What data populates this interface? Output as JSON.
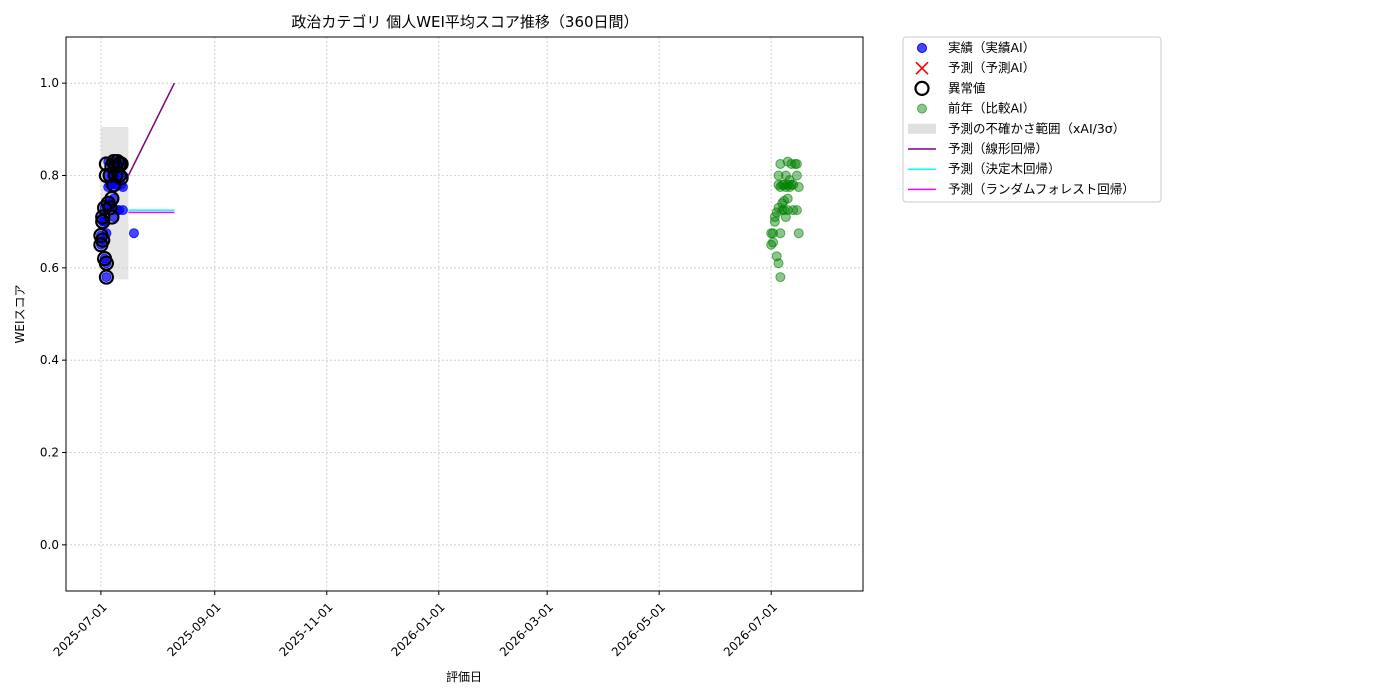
{
  "chart_data": {
    "type": "scatter",
    "title": "政治カテゴリ 個人WEI平均スコア推移（360日間）",
    "xlabel": "評価日",
    "ylabel": "WEIスコア",
    "x_axis": "date",
    "xlim": [
      "2025-06-12",
      "2026-08-20"
    ],
    "ylim": [
      -0.1,
      1.1
    ],
    "x_ticks": [
      "2025-07-01",
      "2025-09-01",
      "2025-11-01",
      "2026-01-01",
      "2026-03-01",
      "2026-05-01",
      "2026-07-01"
    ],
    "y_ticks": [
      0.0,
      0.2,
      0.4,
      0.6,
      0.8,
      1.0
    ],
    "y_tick_labels": [
      "0.0",
      "0.2",
      "0.4",
      "0.6",
      "0.8",
      "1.0"
    ],
    "grid": true,
    "legend_placement": "outside-right",
    "colors": {
      "actual": "#0000ff",
      "predicted": "#ff0000",
      "anomaly": "#000000",
      "previous_year": "#008000",
      "uncertainty": "#d3d3d3",
      "linear": "#800080",
      "tree": "#00ffff",
      "forest": "#ff00ff"
    },
    "series": [
      {
        "name": "実績（実績AI）",
        "kind": "scatter",
        "points": [
          [
            "2025-07-01",
            0.65
          ],
          [
            "2025-07-01",
            0.67
          ],
          [
            "2025-07-02",
            0.66
          ],
          [
            "2025-07-02",
            0.7
          ],
          [
            "2025-07-02",
            0.71
          ],
          [
            "2025-07-03",
            0.62
          ],
          [
            "2025-07-03",
            0.7
          ],
          [
            "2025-07-03",
            0.73
          ],
          [
            "2025-07-04",
            0.61
          ],
          [
            "2025-07-04",
            0.58
          ],
          [
            "2025-07-04",
            0.675
          ],
          [
            "2025-07-05",
            0.8
          ],
          [
            "2025-07-05",
            0.83
          ],
          [
            "2025-07-05",
            0.775
          ],
          [
            "2025-07-05",
            0.74
          ],
          [
            "2025-07-06",
            0.745
          ],
          [
            "2025-07-06",
            0.73
          ],
          [
            "2025-07-06",
            0.78
          ],
          [
            "2025-07-07",
            0.78
          ],
          [
            "2025-07-07",
            0.8
          ],
          [
            "2025-07-07",
            0.82
          ],
          [
            "2025-07-08",
            0.71
          ],
          [
            "2025-07-08",
            0.83
          ],
          [
            "2025-07-08",
            0.75
          ],
          [
            "2025-07-09",
            0.8
          ],
          [
            "2025-07-09",
            0.78
          ],
          [
            "2025-07-10",
            0.82
          ],
          [
            "2025-07-10",
            0.725
          ],
          [
            "2025-07-10",
            0.78
          ],
          [
            "2025-07-11",
            0.8
          ],
          [
            "2025-07-11",
            0.83
          ],
          [
            "2025-07-11",
            0.725
          ],
          [
            "2025-07-12",
            0.825
          ],
          [
            "2025-07-12",
            0.78
          ],
          [
            "2025-07-13",
            0.8
          ],
          [
            "2025-07-13",
            0.725
          ],
          [
            "2025-07-13",
            0.775
          ],
          [
            "2025-07-19",
            0.675
          ]
        ]
      },
      {
        "name": "予測（予測AI）",
        "kind": "scatter",
        "points": []
      },
      {
        "name": "異常値",
        "kind": "scatter",
        "points": [
          [
            "2025-07-01",
            0.65
          ],
          [
            "2025-07-01",
            0.67
          ],
          [
            "2025-07-02",
            0.66
          ],
          [
            "2025-07-02",
            0.7
          ],
          [
            "2025-07-02",
            0.71
          ],
          [
            "2025-07-03",
            0.62
          ],
          [
            "2025-07-03",
            0.73
          ],
          [
            "2025-07-04",
            0.61
          ],
          [
            "2025-07-04",
            0.58
          ],
          [
            "2025-07-04",
            0.8
          ],
          [
            "2025-07-04",
            0.825
          ],
          [
            "2025-07-05",
            0.74
          ],
          [
            "2025-07-06",
            0.73
          ],
          [
            "2025-07-06",
            0.8
          ],
          [
            "2025-07-07",
            0.82
          ],
          [
            "2025-07-07",
            0.71
          ],
          [
            "2025-07-07",
            0.75
          ],
          [
            "2025-07-08",
            0.83
          ],
          [
            "2025-07-08",
            0.78
          ],
          [
            "2025-07-09",
            0.8
          ],
          [
            "2025-07-09",
            0.82
          ],
          [
            "2025-07-10",
            0.83
          ],
          [
            "2025-07-11",
            0.8
          ],
          [
            "2025-07-11",
            0.825
          ],
          [
            "2025-07-12",
            0.825
          ],
          [
            "2025-07-12",
            0.795
          ]
        ]
      },
      {
        "name": "前年（比較AI）",
        "kind": "scatter",
        "points": [
          [
            "2026-07-01",
            0.675
          ],
          [
            "2026-07-01",
            0.65
          ],
          [
            "2026-07-02",
            0.675
          ],
          [
            "2026-07-02",
            0.655
          ],
          [
            "2026-07-03",
            0.71
          ],
          [
            "2026-07-03",
            0.7
          ],
          [
            "2026-07-04",
            0.625
          ],
          [
            "2026-07-04",
            0.72
          ],
          [
            "2026-07-05",
            0.61
          ],
          [
            "2026-07-05",
            0.73
          ],
          [
            "2026-07-05",
            0.78
          ],
          [
            "2026-07-05",
            0.8
          ],
          [
            "2026-07-06",
            0.58
          ],
          [
            "2026-07-06",
            0.825
          ],
          [
            "2026-07-06",
            0.675
          ],
          [
            "2026-07-06",
            0.775
          ],
          [
            "2026-07-07",
            0.74
          ],
          [
            "2026-07-07",
            0.725
          ],
          [
            "2026-07-07",
            0.78
          ],
          [
            "2026-07-08",
            0.745
          ],
          [
            "2026-07-08",
            0.78
          ],
          [
            "2026-07-08",
            0.725
          ],
          [
            "2026-07-09",
            0.8
          ],
          [
            "2026-07-09",
            0.775
          ],
          [
            "2026-07-09",
            0.71
          ],
          [
            "2026-07-10",
            0.83
          ],
          [
            "2026-07-10",
            0.75
          ],
          [
            "2026-07-10",
            0.78
          ],
          [
            "2026-07-10",
            0.725
          ],
          [
            "2026-07-11",
            0.79
          ],
          [
            "2026-07-11",
            0.775
          ],
          [
            "2026-07-12",
            0.825
          ],
          [
            "2026-07-12",
            0.78
          ],
          [
            "2026-07-13",
            0.78
          ],
          [
            "2026-07-13",
            0.725
          ],
          [
            "2026-07-14",
            0.825
          ],
          [
            "2026-07-15",
            0.825
          ],
          [
            "2026-07-15",
            0.8
          ],
          [
            "2026-07-15",
            0.725
          ],
          [
            "2026-07-16",
            0.775
          ],
          [
            "2026-07-16",
            0.675
          ]
        ]
      },
      {
        "name": "予測の不確かさ範囲（xAI/3σ）",
        "kind": "band",
        "x_range": [
          "2025-07-01",
          "2025-07-16"
        ],
        "y_range": [
          0.575,
          0.905
        ]
      },
      {
        "name": "予測（線形回帰）",
        "kind": "line",
        "points": [
          [
            "2025-07-16",
            0.8
          ],
          [
            "2025-08-10",
            1.0
          ]
        ]
      },
      {
        "name": "予測（決定木回帰）",
        "kind": "line",
        "points": [
          [
            "2025-07-16",
            0.725
          ],
          [
            "2025-08-10",
            0.725
          ]
        ]
      },
      {
        "name": "予測（ランダムフォレスト回帰）",
        "kind": "line",
        "points": [
          [
            "2025-07-16",
            0.72
          ],
          [
            "2025-08-10",
            0.72
          ]
        ]
      }
    ]
  }
}
